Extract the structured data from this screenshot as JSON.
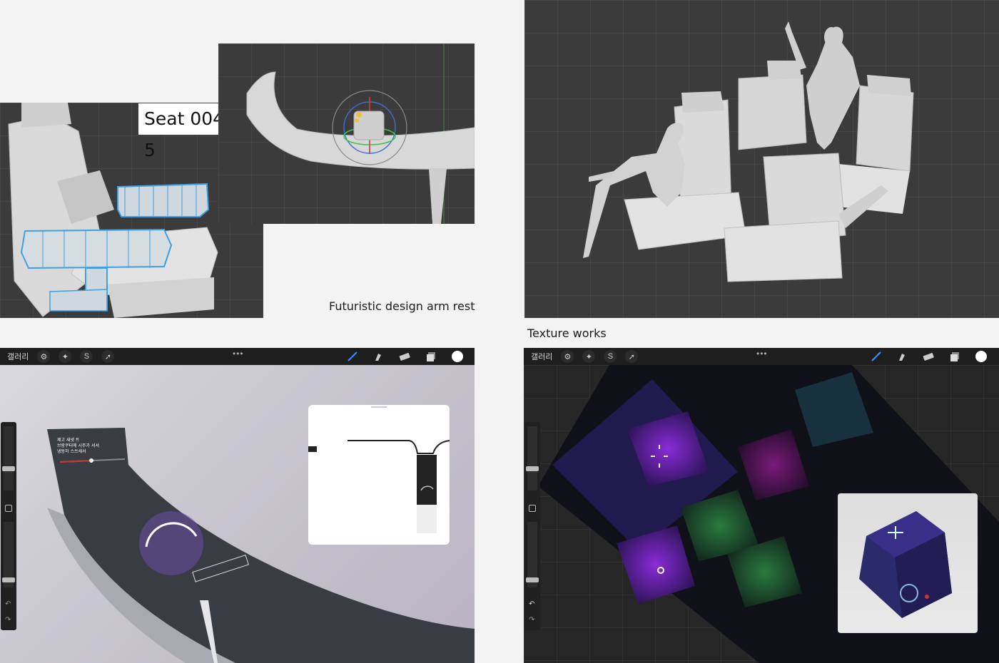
{
  "captions": {
    "seat_label": "Seat 004-5",
    "armrest_caption": "Futuristic design arm rest",
    "texture_caption": "Texture works"
  },
  "procreate_left": {
    "gallery_label": "갤러리",
    "more_dots": "•••",
    "tool_icons": [
      "wrench-icon",
      "magic-wand-icon",
      "selection-icon",
      "transform-arrow-icon"
    ],
    "right_tools": [
      "brush-icon",
      "smudge-icon",
      "eraser-icon",
      "layers-icon",
      "color-circle"
    ],
    "armrest_screen_text": [
      "제고 새넷 트",
      "브랑쿠터에 시주가 서서",
      "냉동하 스쓰세서"
    ]
  },
  "procreate_right": {
    "gallery_label": "갤러리",
    "more_dots": "•••",
    "tool_icons": [
      "wrench-icon",
      "magic-wand-icon",
      "selection-icon",
      "transform-arrow-icon"
    ],
    "right_tools": [
      "brush-icon",
      "smudge-icon",
      "eraser-icon",
      "layers-icon",
      "color-circle"
    ]
  },
  "colors": {
    "page_bg": "#f3f3f3",
    "viewport_bg": "#3a3a3a",
    "wire_blue": "#3f9fe0",
    "accent_purple": "#7a2fd0",
    "toolbar_bg": "#1e1e1e"
  }
}
